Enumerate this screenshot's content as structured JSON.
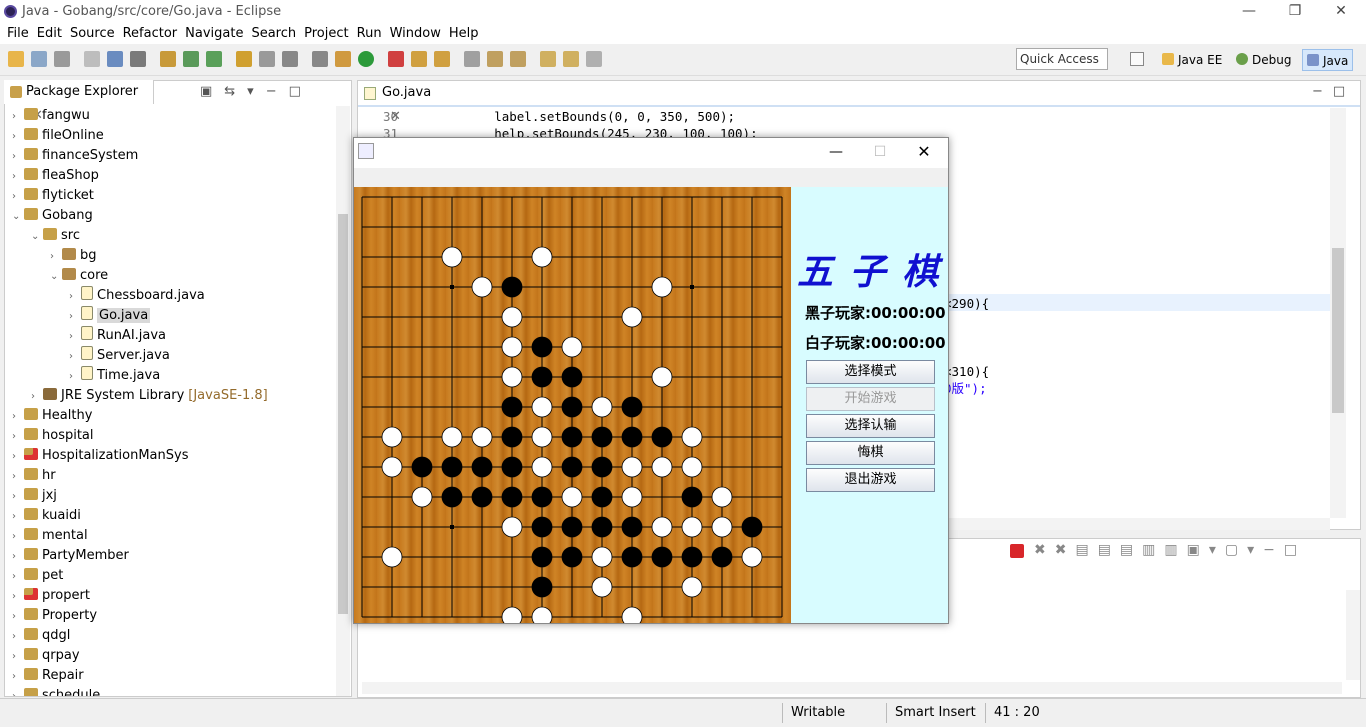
{
  "window": {
    "title": "Java - Gobang/src/core/Go.java - Eclipse"
  },
  "menu": [
    "File",
    "Edit",
    "Source",
    "Refactor",
    "Navigate",
    "Search",
    "Project",
    "Run",
    "Window",
    "Help"
  ],
  "toolbar": {
    "quick_access": "Quick Access",
    "perspectives": [
      "Java EE",
      "Debug",
      "Java"
    ]
  },
  "explorer": {
    "title": "Package Explorer",
    "items": [
      {
        "label": "fangwu",
        "depth": 0,
        "exp": false,
        "kind": "proj"
      },
      {
        "label": "fileOnline",
        "depth": 0,
        "exp": false,
        "kind": "proj"
      },
      {
        "label": "financeSystem",
        "depth": 0,
        "exp": false,
        "kind": "proj"
      },
      {
        "label": "fleaShop",
        "depth": 0,
        "exp": false,
        "kind": "proj"
      },
      {
        "label": "flyticket",
        "depth": 0,
        "exp": false,
        "kind": "proj"
      },
      {
        "label": "Gobang",
        "depth": 0,
        "exp": true,
        "kind": "proj"
      },
      {
        "label": "src",
        "depth": 1,
        "exp": true,
        "kind": "src"
      },
      {
        "label": "bg",
        "depth": 2,
        "exp": false,
        "kind": "pkg"
      },
      {
        "label": "core",
        "depth": 2,
        "exp": true,
        "kind": "pkg"
      },
      {
        "label": "Chessboard.java",
        "depth": 3,
        "exp": false,
        "kind": "java"
      },
      {
        "label": "Go.java",
        "depth": 3,
        "exp": false,
        "kind": "java",
        "selected": true
      },
      {
        "label": "RunAI.java",
        "depth": 3,
        "exp": false,
        "kind": "java"
      },
      {
        "label": "Server.java",
        "depth": 3,
        "exp": false,
        "kind": "java"
      },
      {
        "label": "Time.java",
        "depth": 3,
        "exp": false,
        "kind": "java"
      },
      {
        "label": "JRE System Library",
        "suffix": "[JavaSE-1.8]",
        "depth": 1,
        "exp": false,
        "kind": "lib"
      },
      {
        "label": "Healthy",
        "depth": 0,
        "exp": false,
        "kind": "proj"
      },
      {
        "label": "hospital",
        "depth": 0,
        "exp": false,
        "kind": "proj"
      },
      {
        "label": "HospitalizationManSys",
        "depth": 0,
        "exp": false,
        "kind": "projerr"
      },
      {
        "label": "hr",
        "depth": 0,
        "exp": false,
        "kind": "proj"
      },
      {
        "label": "jxj",
        "depth": 0,
        "exp": false,
        "kind": "proj"
      },
      {
        "label": "kuaidi",
        "depth": 0,
        "exp": false,
        "kind": "proj"
      },
      {
        "label": "mental",
        "depth": 0,
        "exp": false,
        "kind": "proj"
      },
      {
        "label": "PartyMember",
        "depth": 0,
        "exp": false,
        "kind": "proj"
      },
      {
        "label": "pet",
        "depth": 0,
        "exp": false,
        "kind": "proj"
      },
      {
        "label": "propert",
        "depth": 0,
        "exp": false,
        "kind": "projerr"
      },
      {
        "label": "Property",
        "depth": 0,
        "exp": false,
        "kind": "proj"
      },
      {
        "label": "qdgl",
        "depth": 0,
        "exp": false,
        "kind": "proj"
      },
      {
        "label": "qrpay",
        "depth": 0,
        "exp": false,
        "kind": "proj"
      },
      {
        "label": "Repair",
        "depth": 0,
        "exp": false,
        "kind": "proj"
      },
      {
        "label": "schedule",
        "depth": 0,
        "exp": false,
        "kind": "proj"
      }
    ]
  },
  "editor": {
    "tab": "Go.java",
    "lines": [
      {
        "n": "30",
        "code": "        label.setBounds(0, 0, 350, 500);"
      },
      {
        "n": "31",
        "code": "        help.setBounds(245, 230, 100, 100);"
      }
    ],
    "fragments": [
      "<290){",
      "<310){",
      "0版\");"
    ]
  },
  "status": {
    "writable": "Writable",
    "insert": "Smart Insert",
    "position": "41 : 20"
  },
  "game": {
    "title_text": "五 子 棋",
    "black_timer": "黑子玩家:00:00:00",
    "white_timer": "白子玩家:00:00:00",
    "buttons": [
      {
        "label": "选择模式",
        "enabled": true
      },
      {
        "label": "开始游戏",
        "enabled": false
      },
      {
        "label": "选择认输",
        "enabled": true
      },
      {
        "label": "悔棋",
        "enabled": true
      },
      {
        "label": "退出游戏",
        "enabled": true
      }
    ],
    "stones": [
      [
        "w",
        3,
        2
      ],
      [
        "w",
        6,
        2
      ],
      [
        "w",
        4,
        3
      ],
      [
        "b",
        5,
        3
      ],
      [
        "w",
        10,
        3
      ],
      [
        "w",
        5,
        4
      ],
      [
        "w",
        9,
        4
      ],
      [
        "w",
        5,
        5
      ],
      [
        "b",
        6,
        5
      ],
      [
        "w",
        7,
        5
      ],
      [
        "w",
        5,
        6
      ],
      [
        "b",
        6,
        6
      ],
      [
        "b",
        7,
        6
      ],
      [
        "w",
        10,
        6
      ],
      [
        "b",
        5,
        7
      ],
      [
        "w",
        6,
        7
      ],
      [
        "b",
        7,
        7
      ],
      [
        "w",
        8,
        7
      ],
      [
        "b",
        9,
        7
      ],
      [
        "w",
        1,
        8
      ],
      [
        "w",
        3,
        8
      ],
      [
        "w",
        4,
        8
      ],
      [
        "b",
        5,
        8
      ],
      [
        "w",
        6,
        8
      ],
      [
        "b",
        7,
        8
      ],
      [
        "b",
        8,
        8
      ],
      [
        "b",
        9,
        8
      ],
      [
        "b",
        10,
        8
      ],
      [
        "w",
        11,
        8
      ],
      [
        "w",
        1,
        9
      ],
      [
        "b",
        2,
        9
      ],
      [
        "b",
        3,
        9
      ],
      [
        "b",
        4,
        9
      ],
      [
        "b",
        5,
        9
      ],
      [
        "w",
        6,
        9
      ],
      [
        "b",
        7,
        9
      ],
      [
        "b",
        8,
        9
      ],
      [
        "w",
        9,
        9
      ],
      [
        "w",
        10,
        9
      ],
      [
        "w",
        11,
        9
      ],
      [
        "w",
        2,
        10
      ],
      [
        "b",
        3,
        10
      ],
      [
        "b",
        4,
        10
      ],
      [
        "b",
        5,
        10
      ],
      [
        "b",
        6,
        10
      ],
      [
        "w",
        7,
        10
      ],
      [
        "b",
        8,
        10
      ],
      [
        "w",
        9,
        10
      ],
      [
        "b",
        11,
        10
      ],
      [
        "w",
        12,
        10
      ],
      [
        "w",
        5,
        11
      ],
      [
        "b",
        6,
        11
      ],
      [
        "b",
        7,
        11
      ],
      [
        "b",
        8,
        11
      ],
      [
        "b",
        9,
        11
      ],
      [
        "w",
        10,
        11
      ],
      [
        "w",
        11,
        11
      ],
      [
        "w",
        12,
        11
      ],
      [
        "b",
        13,
        11
      ],
      [
        "w",
        1,
        12
      ],
      [
        "b",
        6,
        12
      ],
      [
        "b",
        7,
        12
      ],
      [
        "w",
        8,
        12
      ],
      [
        "b",
        9,
        12
      ],
      [
        "b",
        10,
        12
      ],
      [
        "b",
        11,
        12
      ],
      [
        "b",
        12,
        12
      ],
      [
        "w",
        13,
        12
      ],
      [
        "b",
        6,
        13
      ],
      [
        "w",
        8,
        13
      ],
      [
        "w",
        11,
        13
      ],
      [
        "w",
        5,
        14
      ],
      [
        "w",
        6,
        14
      ],
      [
        "w",
        9,
        14
      ]
    ],
    "star_points": [
      [
        3,
        3
      ],
      [
        11,
        3
      ],
      [
        3,
        11
      ]
    ]
  }
}
